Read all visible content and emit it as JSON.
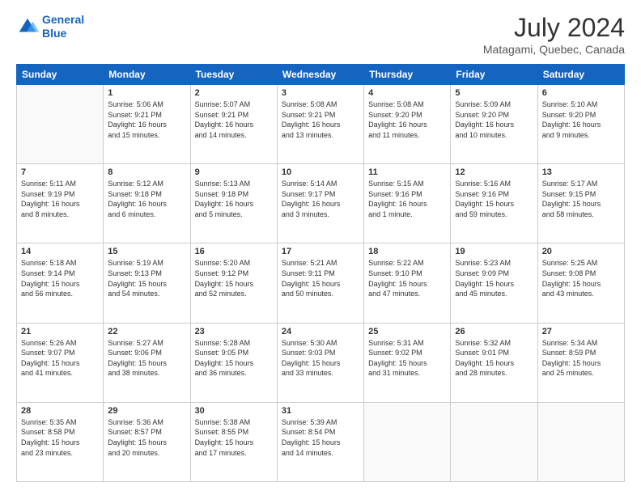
{
  "logo": {
    "line1": "General",
    "line2": "Blue"
  },
  "title": "July 2024",
  "subtitle": "Matagami, Quebec, Canada",
  "weekdays": [
    "Sunday",
    "Monday",
    "Tuesday",
    "Wednesday",
    "Thursday",
    "Friday",
    "Saturday"
  ],
  "weeks": [
    [
      {
        "day": "",
        "info": ""
      },
      {
        "day": "1",
        "info": "Sunrise: 5:06 AM\nSunset: 9:21 PM\nDaylight: 16 hours\nand 15 minutes."
      },
      {
        "day": "2",
        "info": "Sunrise: 5:07 AM\nSunset: 9:21 PM\nDaylight: 16 hours\nand 14 minutes."
      },
      {
        "day": "3",
        "info": "Sunrise: 5:08 AM\nSunset: 9:21 PM\nDaylight: 16 hours\nand 13 minutes."
      },
      {
        "day": "4",
        "info": "Sunrise: 5:08 AM\nSunset: 9:20 PM\nDaylight: 16 hours\nand 11 minutes."
      },
      {
        "day": "5",
        "info": "Sunrise: 5:09 AM\nSunset: 9:20 PM\nDaylight: 16 hours\nand 10 minutes."
      },
      {
        "day": "6",
        "info": "Sunrise: 5:10 AM\nSunset: 9:20 PM\nDaylight: 16 hours\nand 9 minutes."
      }
    ],
    [
      {
        "day": "7",
        "info": "Sunrise: 5:11 AM\nSunset: 9:19 PM\nDaylight: 16 hours\nand 8 minutes."
      },
      {
        "day": "8",
        "info": "Sunrise: 5:12 AM\nSunset: 9:18 PM\nDaylight: 16 hours\nand 6 minutes."
      },
      {
        "day": "9",
        "info": "Sunrise: 5:13 AM\nSunset: 9:18 PM\nDaylight: 16 hours\nand 5 minutes."
      },
      {
        "day": "10",
        "info": "Sunrise: 5:14 AM\nSunset: 9:17 PM\nDaylight: 16 hours\nand 3 minutes."
      },
      {
        "day": "11",
        "info": "Sunrise: 5:15 AM\nSunset: 9:16 PM\nDaylight: 16 hours\nand 1 minute."
      },
      {
        "day": "12",
        "info": "Sunrise: 5:16 AM\nSunset: 9:16 PM\nDaylight: 15 hours\nand 59 minutes."
      },
      {
        "day": "13",
        "info": "Sunrise: 5:17 AM\nSunset: 9:15 PM\nDaylight: 15 hours\nand 58 minutes."
      }
    ],
    [
      {
        "day": "14",
        "info": "Sunrise: 5:18 AM\nSunset: 9:14 PM\nDaylight: 15 hours\nand 56 minutes."
      },
      {
        "day": "15",
        "info": "Sunrise: 5:19 AM\nSunset: 9:13 PM\nDaylight: 15 hours\nand 54 minutes."
      },
      {
        "day": "16",
        "info": "Sunrise: 5:20 AM\nSunset: 9:12 PM\nDaylight: 15 hours\nand 52 minutes."
      },
      {
        "day": "17",
        "info": "Sunrise: 5:21 AM\nSunset: 9:11 PM\nDaylight: 15 hours\nand 50 minutes."
      },
      {
        "day": "18",
        "info": "Sunrise: 5:22 AM\nSunset: 9:10 PM\nDaylight: 15 hours\nand 47 minutes."
      },
      {
        "day": "19",
        "info": "Sunrise: 5:23 AM\nSunset: 9:09 PM\nDaylight: 15 hours\nand 45 minutes."
      },
      {
        "day": "20",
        "info": "Sunrise: 5:25 AM\nSunset: 9:08 PM\nDaylight: 15 hours\nand 43 minutes."
      }
    ],
    [
      {
        "day": "21",
        "info": "Sunrise: 5:26 AM\nSunset: 9:07 PM\nDaylight: 15 hours\nand 41 minutes."
      },
      {
        "day": "22",
        "info": "Sunrise: 5:27 AM\nSunset: 9:06 PM\nDaylight: 15 hours\nand 38 minutes."
      },
      {
        "day": "23",
        "info": "Sunrise: 5:28 AM\nSunset: 9:05 PM\nDaylight: 15 hours\nand 36 minutes."
      },
      {
        "day": "24",
        "info": "Sunrise: 5:30 AM\nSunset: 9:03 PM\nDaylight: 15 hours\nand 33 minutes."
      },
      {
        "day": "25",
        "info": "Sunrise: 5:31 AM\nSunset: 9:02 PM\nDaylight: 15 hours\nand 31 minutes."
      },
      {
        "day": "26",
        "info": "Sunrise: 5:32 AM\nSunset: 9:01 PM\nDaylight: 15 hours\nand 28 minutes."
      },
      {
        "day": "27",
        "info": "Sunrise: 5:34 AM\nSunset: 8:59 PM\nDaylight: 15 hours\nand 25 minutes."
      }
    ],
    [
      {
        "day": "28",
        "info": "Sunrise: 5:35 AM\nSunset: 8:58 PM\nDaylight: 15 hours\nand 23 minutes."
      },
      {
        "day": "29",
        "info": "Sunrise: 5:36 AM\nSunset: 8:57 PM\nDaylight: 15 hours\nand 20 minutes."
      },
      {
        "day": "30",
        "info": "Sunrise: 5:38 AM\nSunset: 8:55 PM\nDaylight: 15 hours\nand 17 minutes."
      },
      {
        "day": "31",
        "info": "Sunrise: 5:39 AM\nSunset: 8:54 PM\nDaylight: 15 hours\nand 14 minutes."
      },
      {
        "day": "",
        "info": ""
      },
      {
        "day": "",
        "info": ""
      },
      {
        "day": "",
        "info": ""
      }
    ]
  ]
}
